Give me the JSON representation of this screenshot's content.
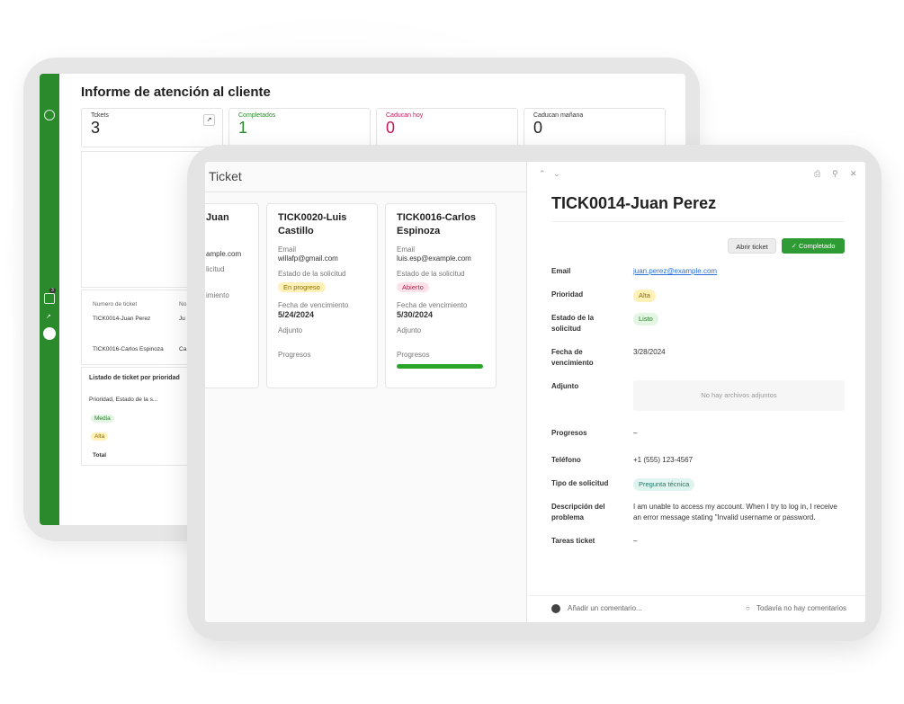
{
  "back": {
    "title": "Informe de atención al cliente",
    "kpis": [
      {
        "label": "Tckets",
        "value": "3"
      },
      {
        "label": "Completados",
        "value": "1"
      },
      {
        "label": "Caducan hoy",
        "value": "0"
      },
      {
        "label": "Caducan mañana",
        "value": "0"
      }
    ],
    "table": {
      "col1": "Numero de ticket",
      "col2": "No",
      "rows": [
        {
          "a": "TICK0014-Juan Perez",
          "b": "Ju"
        },
        {
          "a": "TICK0016-Carlos Espinoza",
          "b": "Ca"
        }
      ]
    },
    "priority": {
      "title": "Listado de ticket por prioridad",
      "subtitle": "Prioridad, Estado de la s...",
      "rows": [
        "Media",
        "Alta",
        "Total"
      ]
    },
    "badge_count": "3"
  },
  "front": {
    "header": "Ticket",
    "cards": [
      {
        "title": "Juan",
        "email": "ample.com",
        "estado_label": "licitud",
        "fecha_label": "imiento"
      },
      {
        "title": "TICK0020-Luis Castillo",
        "email_label": "Email",
        "email": "willafp@gmail.com",
        "estado_label": "Estado de la solicitud",
        "estado": "En progreso",
        "fecha_label": "Fecha de vencimiento",
        "fecha": "5/24/2024",
        "adjunto_label": "Adjunto",
        "progresos_label": "Progresos"
      },
      {
        "title": "TICK0016-Carlos Espinoza",
        "email_label": "Email",
        "email": "luis.esp@example.com",
        "estado_label": "Estado de la solicitud",
        "estado": "Abierto",
        "fecha_label": "Fecha de vencimiento",
        "fecha": "5/30/2024",
        "adjunto_label": "Adjunto",
        "progresos_label": "Progresos",
        "progress": 1.0
      }
    ],
    "detail": {
      "title": "TICK0014-Juan Perez",
      "btn_open": "Abrir ticket",
      "btn_done": "Completado",
      "email_label": "Email",
      "email": "juan.perez@example.com",
      "prioridad_label": "Prioridad",
      "prioridad": "Alta",
      "estado_label": "Estado de la solicitud",
      "estado": "Listo",
      "fecha_label": "Fecha de vencimiento",
      "fecha": "3/28/2024",
      "adjunto_label": "Adjunto",
      "adjunto": "No hay archivos adjuntos",
      "progresos_label": "Progresos",
      "progresos": "–",
      "telefono_label": "Teléfono",
      "telefono": "+1 (555) 123-4567",
      "tipo_label": "Tipo de solicitud",
      "tipo": "Pregunta técnica",
      "desc_label": "Descripción del problema",
      "desc": "I am unable to access my account. When I try to log in, I receive an error message stating \"Invalid username or password.",
      "tareas_label": "Tareas ticket",
      "tareas": "–",
      "comment_placeholder": "Añadir un comentario...",
      "no_comments": "Todavía no hay comentarios"
    }
  }
}
